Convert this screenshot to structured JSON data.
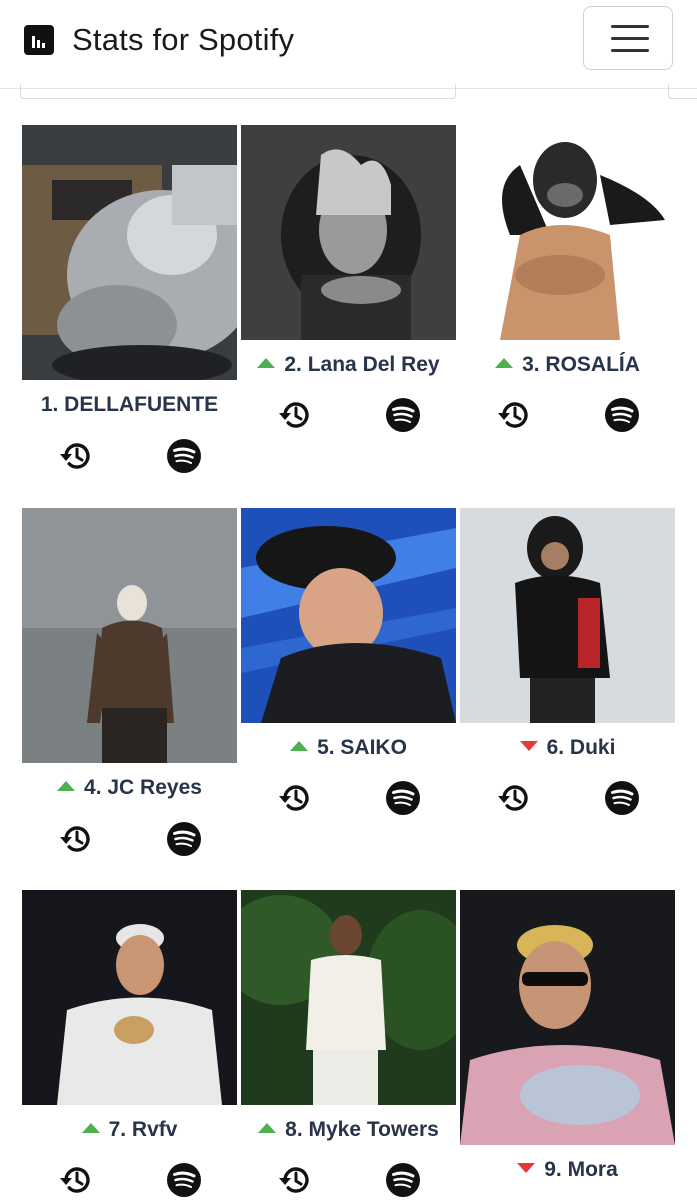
{
  "app": {
    "title": "Stats for Spotify"
  },
  "artists": [
    {
      "rank_label": "1. DELLAFUENTE",
      "trend": "none",
      "image": "silver-scooter"
    },
    {
      "rank_label": "2. Lana Del Rey",
      "trend": "up",
      "image": "grayscale-portrait"
    },
    {
      "rank_label": "3. ROSALÍA",
      "trend": "up",
      "image": "helmet-figure"
    },
    {
      "rank_label": "4. JC Reyes",
      "trend": "up",
      "image": "tattooed-man"
    },
    {
      "rank_label": "5. SAIKO",
      "trend": "up",
      "image": "cap-blue-light"
    },
    {
      "rank_label": "6. Duki",
      "trend": "down",
      "image": "supreme-jacket"
    },
    {
      "rank_label": "7. Rvfv",
      "trend": "up",
      "image": "white-sweater"
    },
    {
      "rank_label": "8. Myke Towers",
      "trend": "up",
      "image": "garden-portrait"
    },
    {
      "rank_label": "9. Mora",
      "trend": "down",
      "image": "sunglasses-portrait"
    }
  ],
  "icons": {
    "history": "history-icon",
    "spotify": "spotify-icon",
    "trend_up": "trend-up-icon",
    "trend_down": "trend-down-icon"
  },
  "colors": {
    "up": "#4caf50",
    "down": "#e53935",
    "label": "#27344a"
  }
}
